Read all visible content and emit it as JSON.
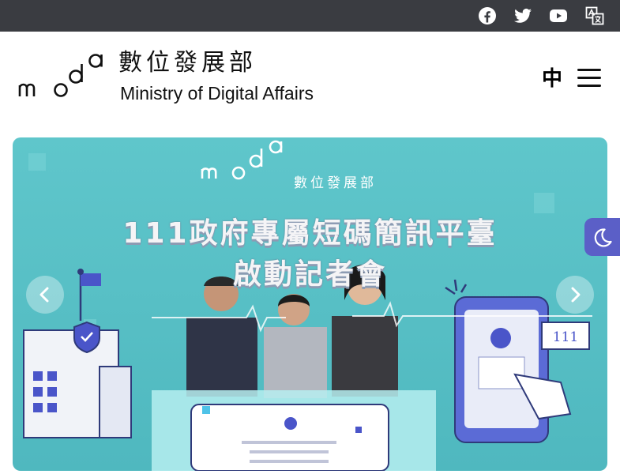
{
  "topbar": {
    "icons": [
      "facebook-icon",
      "twitter-icon",
      "youtube-icon",
      "translate-icon"
    ]
  },
  "header": {
    "logo_mark": "moda",
    "logo_zh": "數位發展部",
    "logo_en": "Ministry of Digital Affairs",
    "lang_label": "中",
    "menu_icon": "hamburger-icon"
  },
  "carousel": {
    "slide": {
      "brand": "moda",
      "brand_zh": "數位發展部",
      "title_line1": "111政府專屬短碼簡訊平臺",
      "title_line2": "啟動記者會",
      "phone_number": "111"
    },
    "prev_icon": "chevron-left-icon",
    "next_icon": "chevron-right-icon"
  },
  "dark_mode": {
    "icon": "moon-icon"
  },
  "colors": {
    "topbar": "#3a3c41",
    "slide_bg": "#5cc3c9",
    "dark_toggle": "#5b5fc7",
    "accent_blue": "#4a55c9"
  }
}
